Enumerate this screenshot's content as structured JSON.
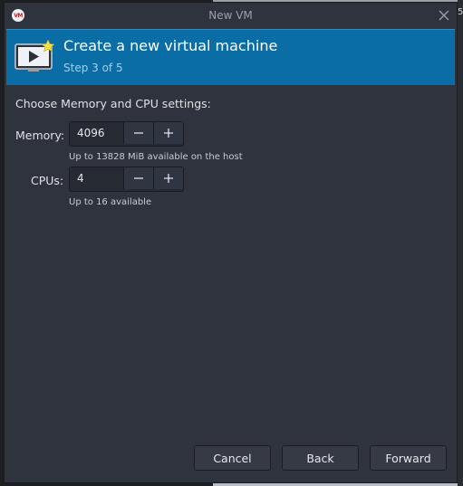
{
  "window": {
    "title": "New VM",
    "logo_text": "VM"
  },
  "header": {
    "title": "Create a new virtual machine",
    "step": "Step 3 of 5"
  },
  "settings": {
    "section_label": "Choose Memory and CPU settings:",
    "memory": {
      "label": "Memory:",
      "value": "4096",
      "hint": "Up to 13828 MiB available on the host"
    },
    "cpus": {
      "label": "CPUs:",
      "value": "4",
      "hint": "Up to 16 available"
    }
  },
  "buttons": {
    "cancel": "Cancel",
    "back": "Back",
    "forward": "Forward"
  },
  "background": {
    "edge_text": "5"
  },
  "colors": {
    "header_bg": "#0a6da6",
    "window_bg": "#2f333d",
    "accent_star": "#f5e04a"
  }
}
